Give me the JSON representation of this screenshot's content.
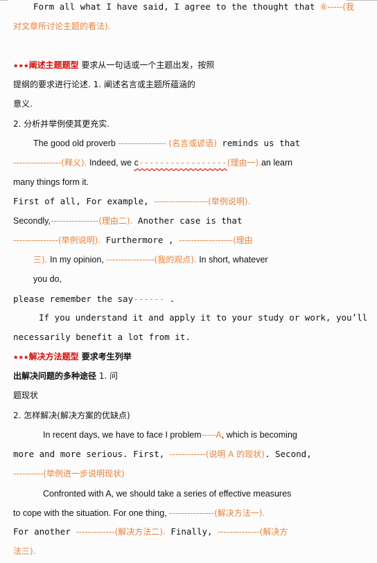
{
  "doc": {
    "l1": {
      "a": "Form all what I have said, I agree to the thought that ",
      "b": "⑥-----(我"
    },
    "l2": {
      "a": "对文章所讨论主题的看法)."
    },
    "sec1": {
      "stars": "★★★",
      "title": "阐述主题题型",
      "desc1": " 要求从一句话或一个主题出发，按照",
      "desc2": "提纲的要求进行论述.  1.     阐述名言或主题所蕴涵的",
      "desc3": "意义.",
      "item2": "2.   分析并举例使其更充实."
    },
    "p1": {
      "a1": "The good old proverb ",
      "a2": "---------------- (名言或谚语)",
      "a3": " reminds us that",
      "b1": "----------------(释义).",
      "b2": " Indeed, we ",
      "b3": "c",
      "b4": "-----------------",
      "b5": "(理由一).",
      "b6": "an learn",
      "c1": "many things form it.",
      "d1": "First of all, For example, ",
      "d2": "------------------(举例说明).",
      "e1": "Secondly,",
      "e2": "----------------(理由二).",
      "e3": " Another case is that",
      "f1": "---------------(举例说明).",
      "f2": " Furthermore , ",
      "f3": "------------------(理由",
      "g1": "三).",
      "g2": "  In my opinion, ",
      "g3": "----------------(我的观点).",
      "g4": " In short, whatever",
      "h1": "you do,",
      "i1": "please remember the say",
      "i2": "------",
      "i3": " .",
      "j1": "If you understand it and apply it to your study or work, you’ll",
      "k1": "necessarily benefit a lot from it."
    },
    "sec2": {
      "stars": "★★★",
      "title": "解决方法题型",
      "desc1": " 要求考生列举",
      "desc2": "出解决问题的多种途径",
      "desc2b": " 1.     问",
      "desc3": "题现状",
      "item2": "2.   怎样解决(解决方案的优缺点)"
    },
    "p2": {
      "a1": "In recent days, we have to face I problem",
      "a2": "-----A",
      "a3": ", which is becoming",
      "b1": "more and more serious. First, ",
      "b2": "------------(说明 A 的现状)",
      "b3": ". Second,",
      "c1": "----------(举例进一步说明现状)"
    },
    "p3": {
      "a1": "Confronted with A, we should take a series of effective measures",
      "b1": "to cope with the situation. For one thing, ",
      "b2": "---------------(解决方法一).",
      "c1": "For another ",
      "c2": "-------------(解决方法二).",
      "c3": " Finally, ",
      "c4": "--------------(解决方",
      "d1": "法三)."
    }
  }
}
